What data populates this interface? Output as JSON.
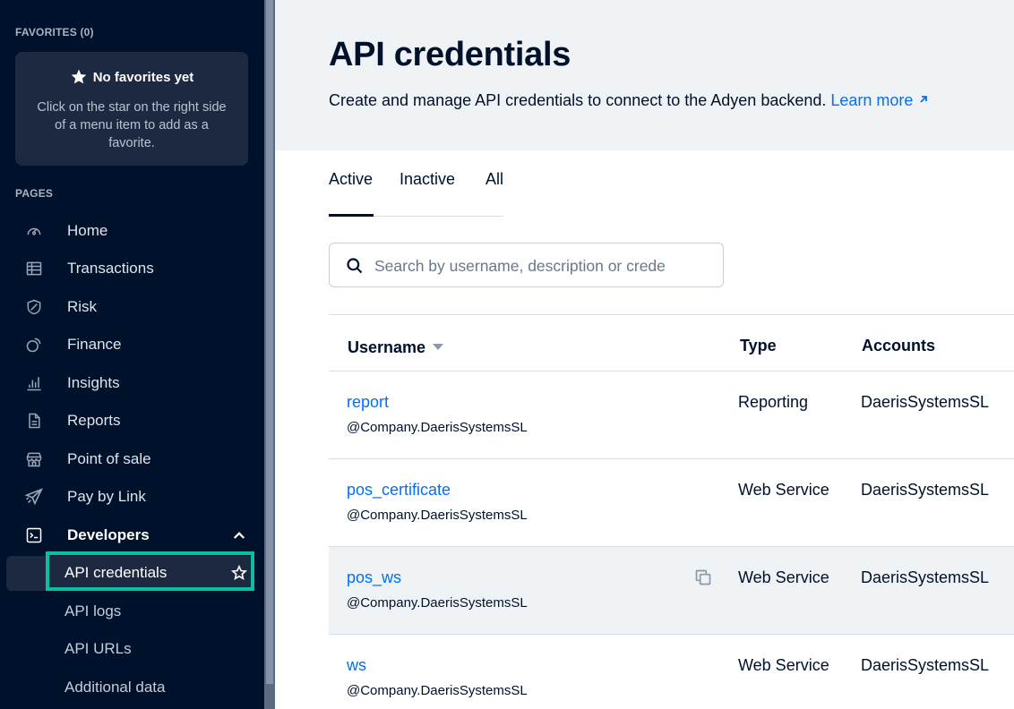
{
  "sidebar": {
    "favorites_label": "FAVORITES (0)",
    "favorites_title": "No favorites yet",
    "favorites_hint": "Click on the star on the right side of a menu item to add as a favorite.",
    "pages_label": "PAGES",
    "items": [
      {
        "label": "Home",
        "icon": "dashboard-icon"
      },
      {
        "label": "Transactions",
        "icon": "table-icon"
      },
      {
        "label": "Risk",
        "icon": "shield-icon"
      },
      {
        "label": "Finance",
        "icon": "finance-icon"
      },
      {
        "label": "Insights",
        "icon": "bar-chart-icon"
      },
      {
        "label": "Reports",
        "icon": "document-icon"
      },
      {
        "label": "Point of sale",
        "icon": "store-icon"
      },
      {
        "label": "Pay by Link",
        "icon": "paper-plane-icon"
      },
      {
        "label": "Developers",
        "icon": "terminal-icon"
      }
    ],
    "developers_sub": [
      {
        "label": "API credentials"
      },
      {
        "label": "API logs"
      },
      {
        "label": "API URLs"
      },
      {
        "label": "Additional data"
      }
    ]
  },
  "header": {
    "title": "API credentials",
    "description": "Create and manage API credentials to connect to the Adyen backend.",
    "learn_more": "Learn more"
  },
  "tabs": [
    {
      "label": "Active"
    },
    {
      "label": "Inactive"
    },
    {
      "label": "All"
    }
  ],
  "search": {
    "placeholder": "Search by username, description or crede"
  },
  "table": {
    "columns": [
      "Username",
      "Type",
      "Accounts"
    ],
    "rows": [
      {
        "username": "report",
        "company": "@Company.DaerisSystemsSL",
        "type": "Reporting",
        "accounts": "DaerisSystemsSL"
      },
      {
        "username": "pos_certificate",
        "company": "@Company.DaerisSystemsSL",
        "type": "Web Service",
        "accounts": "DaerisSystemsSL"
      },
      {
        "username": "pos_ws",
        "company": "@Company.DaerisSystemsSL",
        "type": "Web Service",
        "accounts": "DaerisSystemsSL"
      },
      {
        "username": "ws",
        "company": "@Company.DaerisSystemsSL",
        "type": "Web Service",
        "accounts": "DaerisSystemsSL"
      }
    ]
  },
  "colors": {
    "sidebar_bg": "#00112c",
    "accent_link": "#0070f5",
    "highlight": "#0abf9f"
  }
}
